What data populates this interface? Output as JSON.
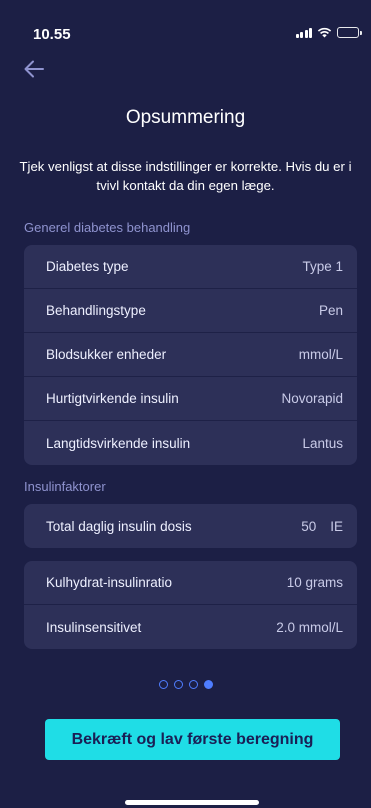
{
  "status_bar": {
    "time": "10.55"
  },
  "header": {
    "title": "Opsummering"
  },
  "intro": "Tjek venligst at disse indstillinger er korrekte. Hvis du er i tvivl kontakt da din egen læge.",
  "sections": {
    "general": {
      "label": "Generel diabetes behandling",
      "rows": [
        {
          "label": "Diabetes type",
          "value": "Type 1"
        },
        {
          "label": "Behandlingstype",
          "value": "Pen"
        },
        {
          "label": "Blodsukker enheder",
          "value": "mmol/L"
        },
        {
          "label": "Hurtigtvirkende insulin",
          "value": "Novorapid"
        },
        {
          "label": "Langtidsvirkende insulin",
          "value": "Lantus"
        }
      ]
    },
    "insulin": {
      "label": "Insulinfaktorer",
      "total": {
        "label": "Total daglig insulin dosis",
        "value": "50",
        "unit": "IE"
      },
      "rows": [
        {
          "label": "Kulhydrat-insulinratio",
          "value": "10 grams"
        },
        {
          "label": "Insulinsensitivet",
          "value": "2.0 mmol/L"
        }
      ]
    }
  },
  "pagination": {
    "total": 4,
    "current": 4
  },
  "confirm_button": "Bekræft og lav første beregning",
  "colors": {
    "background": "#1c1f45",
    "card": "#2d3058",
    "accent": "#1fdde6",
    "section_label": "#8f93cf",
    "dot": "#4f7dff"
  }
}
